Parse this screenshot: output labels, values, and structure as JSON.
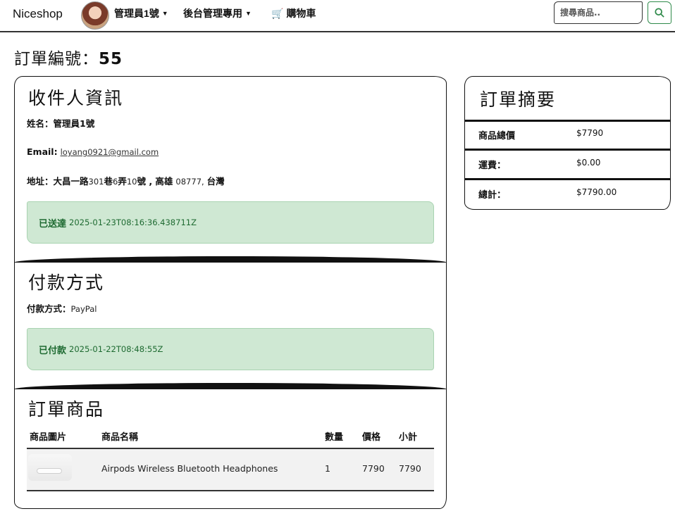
{
  "navbar": {
    "brand": "Niceshop",
    "user_menu": "管理員1號",
    "admin_menu": "後台管理專用",
    "cart": "購物車",
    "search_placeholder": "搜尋商品..",
    "icons": {
      "cart": "cart-icon",
      "search": "search-icon",
      "caret": "caret-down-icon"
    }
  },
  "page": {
    "title_label": "訂單編號：",
    "order_number": "55"
  },
  "recipient": {
    "heading": "收件人資訊",
    "name_label": "姓名：",
    "name_value": "管理員1號",
    "email_label": "Email:",
    "email_value": "loyang0921@gmail.com",
    "address_label": "地址：",
    "address_value_1": "大昌一路",
    "address_value_2": "301",
    "address_value_3": "巷",
    "address_value_4": "6",
    "address_value_5": "弄",
    "address_value_6": "10",
    "address_value_7": "號 , 高雄",
    "address_value_8": "08777,",
    "address_value_9": "台灣",
    "delivery_status": "已送達",
    "delivery_time": "2025-01-23T08:16:36.438711Z"
  },
  "payment": {
    "heading": "付款方式",
    "method_label": "付款方式：",
    "method_value": "PayPal",
    "paid_status": "已付款",
    "paid_time": "2025-01-22T08:48:55Z"
  },
  "items": {
    "heading": "訂單商品",
    "columns": [
      "商品圖片",
      "商品名稱",
      "數量",
      "價格",
      "小計"
    ],
    "rows": [
      {
        "name": "Airpods Wireless Bluetooth Headphones",
        "qty": "1",
        "price": "7790",
        "subtotal": "7790"
      }
    ]
  },
  "summary": {
    "heading": "訂單摘要",
    "rows": [
      {
        "label": "商品總價",
        "value": "$7790"
      },
      {
        "label": "運費：",
        "value": "$0.00"
      },
      {
        "label": "總計：",
        "value": "$7790.00"
      }
    ]
  },
  "colors": {
    "success_bg": "#cfe8d3",
    "success_text": "#1e6a31",
    "search_button": "#2f8a4a"
  }
}
